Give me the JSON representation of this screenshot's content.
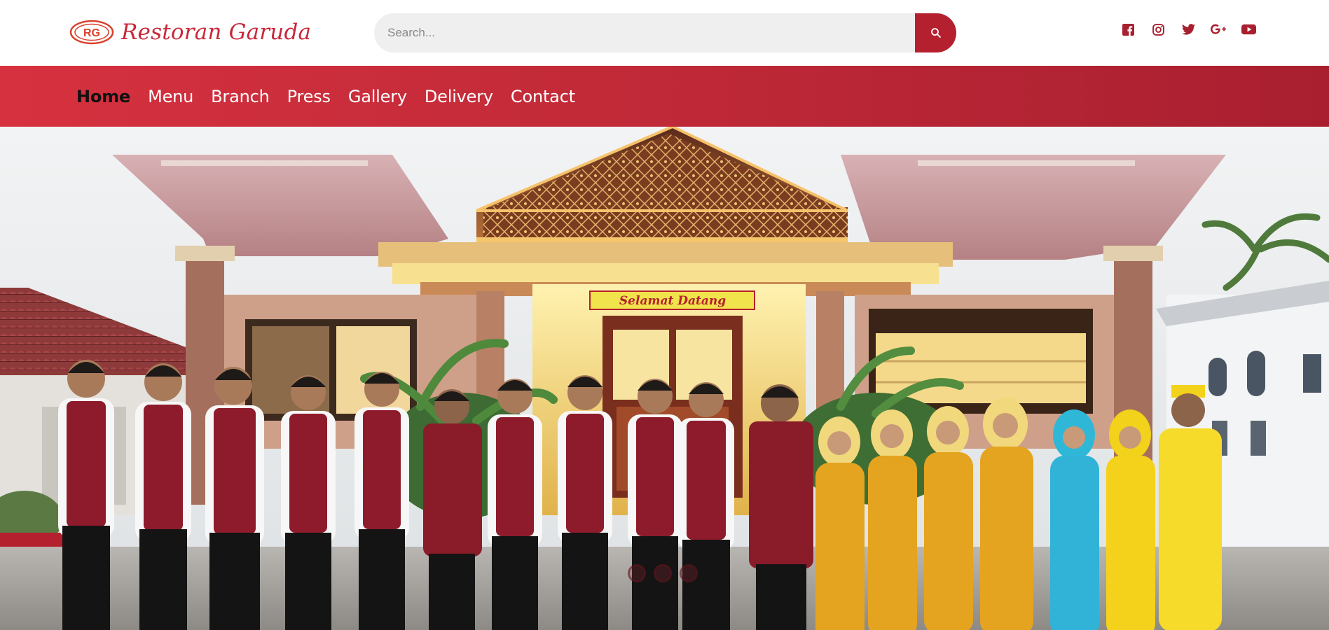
{
  "brand": {
    "name": "Restoran Garuda",
    "logo_icon": "garuda-logo",
    "logo_text": "RG"
  },
  "search": {
    "placeholder": "Search...",
    "value": "",
    "button_icon": "search-icon"
  },
  "socials": [
    {
      "icon": "facebook-icon"
    },
    {
      "icon": "instagram-icon"
    },
    {
      "icon": "twitter-icon"
    },
    {
      "icon": "google-plus-icon"
    },
    {
      "icon": "youtube-icon"
    }
  ],
  "nav": {
    "items": [
      {
        "label": "Home",
        "active": true
      },
      {
        "label": "Menu"
      },
      {
        "label": "Branch"
      },
      {
        "label": "Press"
      },
      {
        "label": "Gallery"
      },
      {
        "label": "Delivery"
      },
      {
        "label": "Contact"
      }
    ]
  },
  "hero": {
    "photo": "restaurant-front-staff-photo",
    "sign_text": "Selamat Datang",
    "slides": {
      "count": 3,
      "active": 1
    }
  },
  "colors": {
    "brand_red": "#c8283a",
    "nav_red": "#c22a38",
    "active_nav": "#111111",
    "search_bg": "#efefef"
  }
}
